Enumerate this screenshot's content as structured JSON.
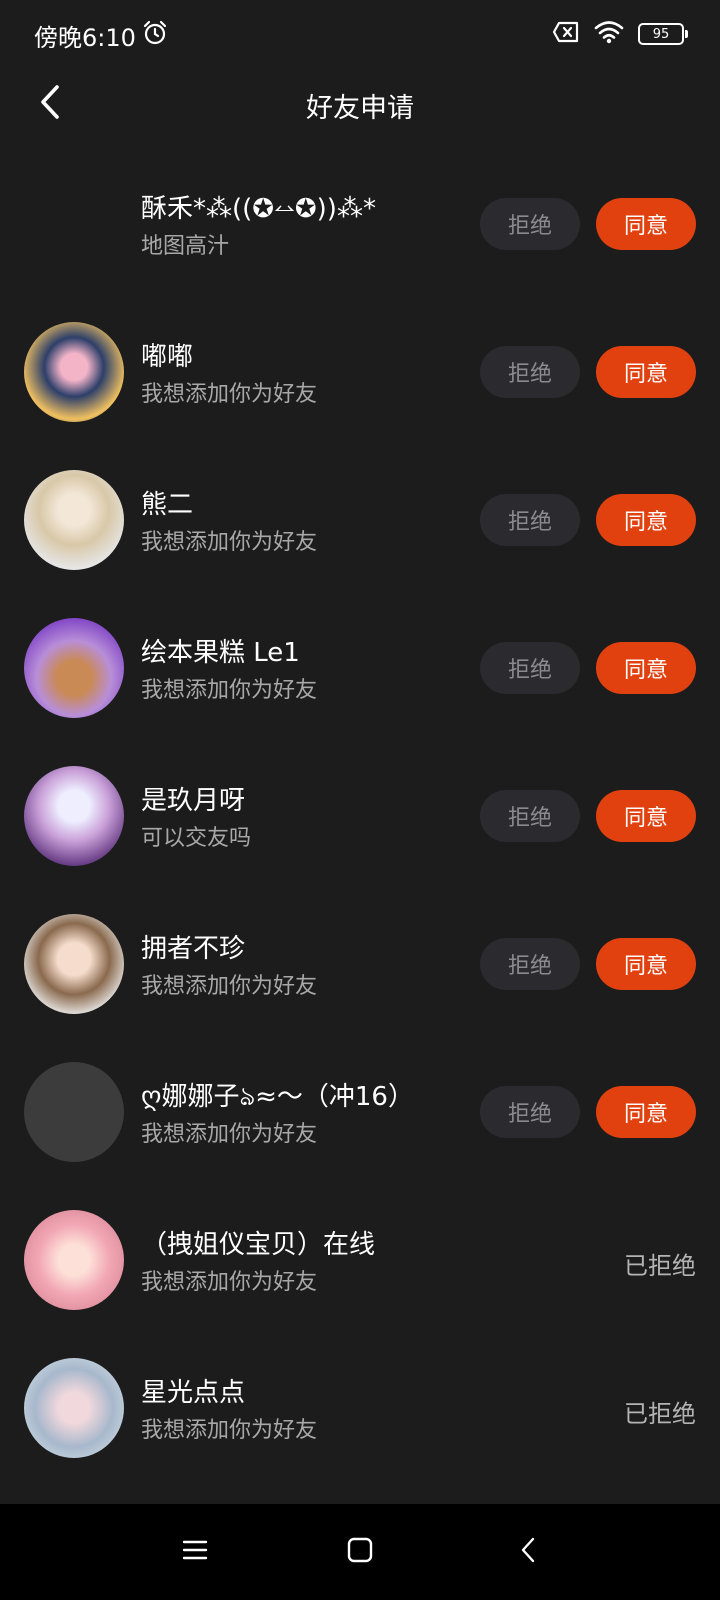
{
  "status_bar": {
    "time": "傍晚6:10",
    "battery": "95"
  },
  "header": {
    "title": "好友申请"
  },
  "buttons": {
    "reject": "拒绝",
    "accept": "同意",
    "rejected": "已拒绝"
  },
  "requests": [
    {
      "name": "酥禾*⁂((✪⥎✪))⁂*",
      "message": "地图高汁",
      "status": "pending"
    },
    {
      "name": "嘟嘟",
      "message": "我想添加你为好友",
      "status": "pending"
    },
    {
      "name": "熊二",
      "message": "我想添加你为好友",
      "status": "pending"
    },
    {
      "name": "绘本果糕 Le1",
      "message": "我想添加你为好友",
      "status": "pending"
    },
    {
      "name": "是玖月呀",
      "message": "可以交友吗",
      "status": "pending"
    },
    {
      "name": "拥者不珍",
      "message": "我想添加你为好友",
      "status": "pending"
    },
    {
      "name": "ღ娜娜子ঌ≈～（冲16）",
      "message": "我想添加你为好友",
      "status": "pending"
    },
    {
      "name": "（拽姐仪宝贝）在线",
      "message": "我想添加你为好友",
      "status": "rejected"
    },
    {
      "name": "星光点点",
      "message": "我想添加你为好友",
      "status": "rejected"
    }
  ],
  "colors": {
    "accept": "#e0410f",
    "reject_bg": "#2b2b2f",
    "background": "#1c1c1c"
  },
  "icons": {
    "alarm": "alarm-icon",
    "sim": "sim-x-icon",
    "wifi": "wifi-icon",
    "back": "back-arrow-icon",
    "menu": "menu-icon",
    "home": "home-icon",
    "nav_back": "nav-back-icon"
  }
}
